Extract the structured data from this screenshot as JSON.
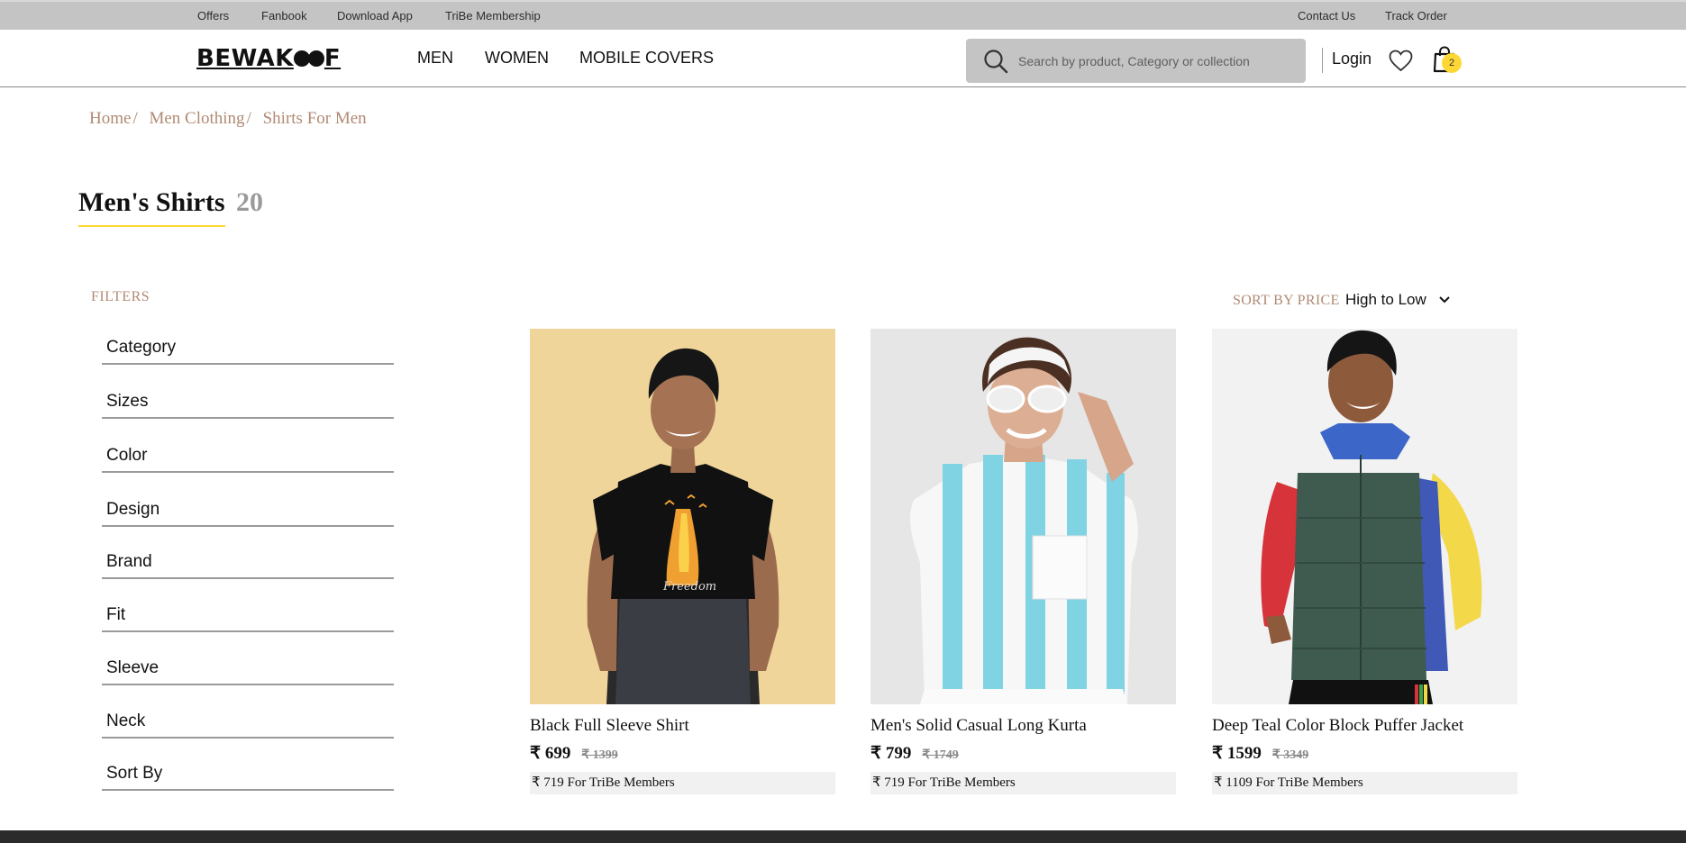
{
  "topbar": {
    "left_links": [
      "Offers",
      "Fanbook",
      "Download App",
      "TriBe Membership"
    ],
    "right_links": [
      "Contact Us",
      "Track Order"
    ]
  },
  "header": {
    "logo": "BEWAKOOF",
    "nav": [
      "MEN",
      "WOMEN",
      "MOBILE COVERS"
    ],
    "search_placeholder": "Search by product, Category or collection",
    "login": "Login",
    "cart_count": "2",
    "cart_badge_color": "#fdd835"
  },
  "breadcrumb": [
    "Home",
    "Men Clothing",
    "Shirts For Men"
  ],
  "page": {
    "title": "Men's Shirts",
    "count": "20"
  },
  "filters": {
    "label": "FILTERS",
    "items": [
      "Category",
      "Sizes",
      "Color",
      "Design",
      "Brand",
      "Fit",
      "Sleeve",
      "Neck",
      "Sort By"
    ]
  },
  "sort": {
    "label": "SORT BY PRICE",
    "value": "High to Low"
  },
  "products": [
    {
      "name": "Black Full Sleeve Shirt",
      "price": "₹ 699",
      "mrp": "₹ 1399",
      "tribe": "₹ 719 For TriBe Members"
    },
    {
      "name": "Men's Solid Casual Long Kurta",
      "price": "₹ 799",
      "mrp": "₹ 1749",
      "tribe": "₹ 719 For TriBe Members"
    },
    {
      "name": "Deep Teal Color Block Puffer Jacket",
      "price": "₹ 1599",
      "mrp": "₹ 3349",
      "tribe": "₹ 1109 For TriBe Members"
    }
  ],
  "colors": {
    "breadcrumb": "#b08a74",
    "accent_yellow": "#fdd835",
    "topbar": "#c4c4c4"
  }
}
